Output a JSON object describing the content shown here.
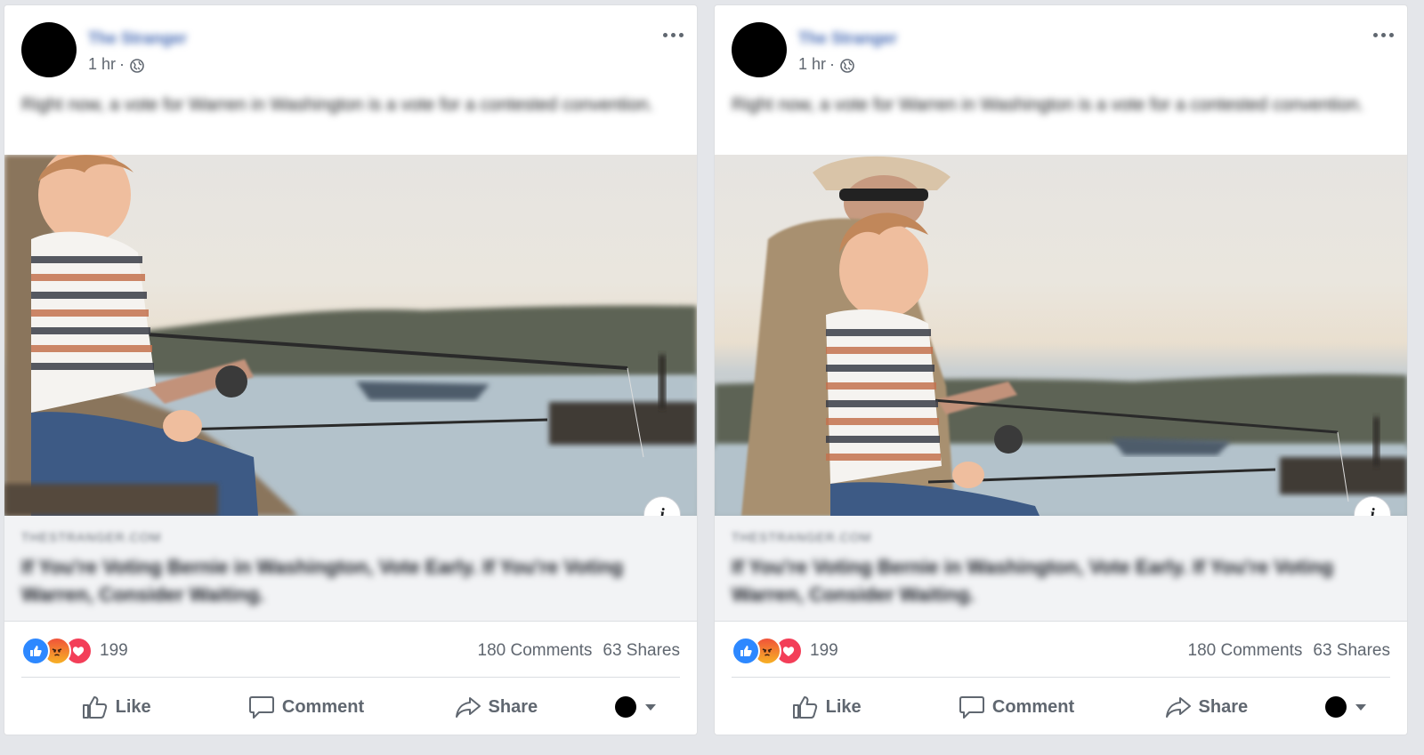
{
  "posts": [
    {
      "page_name": "The Stranger",
      "time": "1 hr",
      "separator": "·",
      "icons": {
        "privacy": "globe-icon",
        "more": "more-options-icon",
        "info": "info-icon"
      },
      "text": "Right now, a vote for Warren in Washington is a vote for a contested convention.",
      "image_alt": "Grandfather and child fishing on a dock by a lake at sunset",
      "info_label": "i",
      "link": {
        "domain": "THESTRANGER.COM",
        "title": "If You're Voting Bernie in Washington, Vote Early. If You're Voting Warren, Consider Waiting."
      },
      "reactions": {
        "types": [
          "like",
          "angry",
          "love"
        ],
        "count": "199"
      },
      "comments": "180 Comments",
      "shares": "63 Shares",
      "actions": {
        "like": "Like",
        "comment": "Comment",
        "share": "Share"
      }
    },
    {
      "page_name": "The Stranger",
      "time": "1 hr",
      "separator": "·",
      "icons": {
        "privacy": "globe-icon",
        "more": "more-options-icon",
        "info": "info-icon"
      },
      "text": "Right now, a vote for Warren in Washington is a vote for a contested convention.",
      "image_alt": "Grandfather and child fishing on a dock by a lake at sunset",
      "info_label": "i",
      "link": {
        "domain": "THESTRANGER.COM",
        "title": "If You're Voting Bernie in Washington, Vote Early. If You're Voting Warren, Consider Waiting."
      },
      "reactions": {
        "types": [
          "like",
          "angry",
          "love"
        ],
        "count": "199"
      },
      "comments": "180 Comments",
      "shares": "63 Shares",
      "actions": {
        "like": "Like",
        "comment": "Comment",
        "share": "Share"
      }
    }
  ],
  "colors": {
    "link_blue": "#4267b2",
    "like_blue": "#2d88ff",
    "love_red": "#f33e58",
    "angry_orange": "#f0533a",
    "secondary_text": "#606770"
  }
}
